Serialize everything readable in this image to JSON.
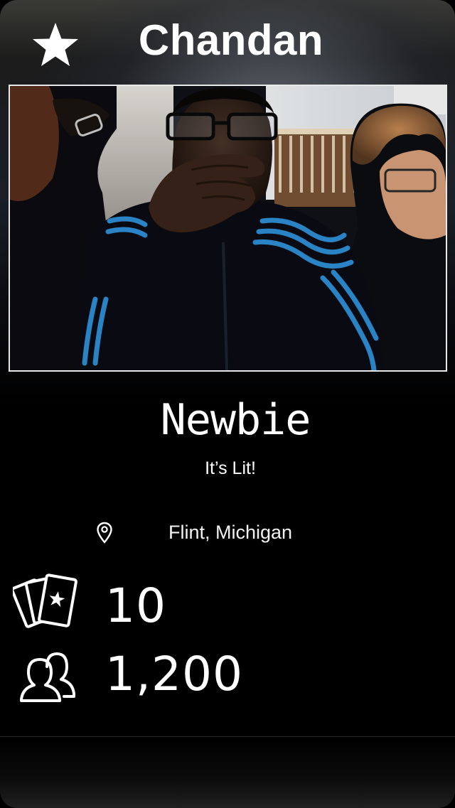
{
  "header": {
    "title": "Chandan",
    "star_icon": "star-icon"
  },
  "photo": {
    "icon": "profile-photo"
  },
  "profile": {
    "rank": "Newbie",
    "tagline": "It’s Lit!",
    "location": "Flint, Michigan",
    "location_icon": "map-pin-icon"
  },
  "stats": {
    "cards_count": "10",
    "cards_icon": "cards-icon",
    "followers_count": "1,200",
    "followers_icon": "followers-icon"
  },
  "colors": {
    "accent_stripes": "#2e8fd6",
    "text": "#ffffff",
    "photo_border": "#e8e8e8"
  }
}
